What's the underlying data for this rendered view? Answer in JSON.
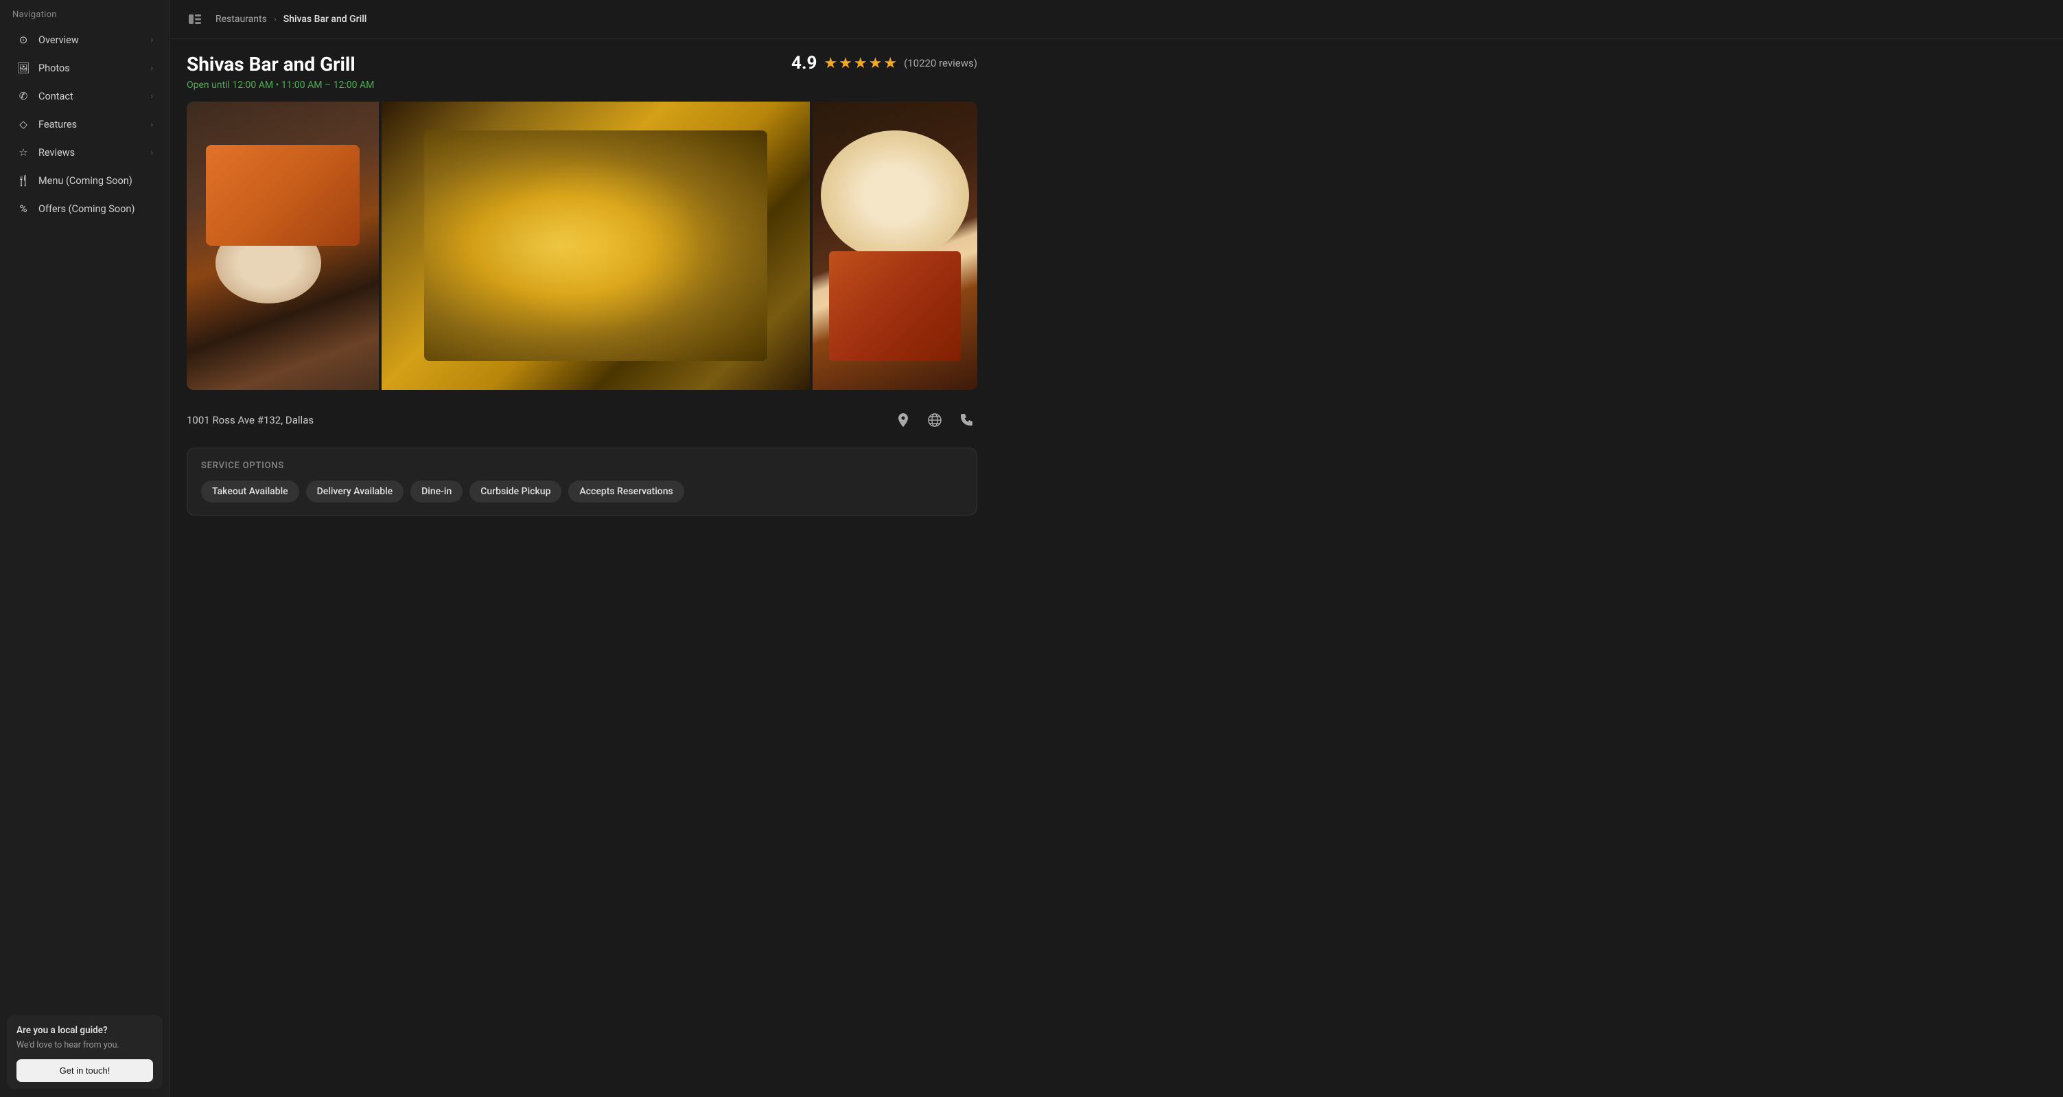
{
  "nav": {
    "label": "Navigation",
    "items": [
      {
        "id": "overview",
        "label": "Overview",
        "icon": "⊙"
      },
      {
        "id": "photos",
        "label": "Photos",
        "icon": "🖼"
      },
      {
        "id": "contact",
        "label": "Contact",
        "icon": "☎"
      },
      {
        "id": "features",
        "label": "Features",
        "icon": "◇"
      },
      {
        "id": "reviews",
        "label": "Reviews",
        "icon": "☆"
      },
      {
        "id": "menu",
        "label": "Menu (Coming Soon)",
        "icon": "🍴"
      },
      {
        "id": "offers",
        "label": "Offers (Coming Soon)",
        "icon": "%"
      }
    ]
  },
  "local_guide": {
    "title": "Are you a local guide?",
    "description": "We'd love to hear from you.",
    "button_label": "Get in touch!"
  },
  "topbar": {
    "breadcrumb_parent": "Restaurants",
    "breadcrumb_current": "Shivas Bar and Grill"
  },
  "restaurant": {
    "name": "Shivas Bar and Grill",
    "rating": "4.9",
    "review_count": "(10220 reviews)",
    "hours": "Open until 12:00 AM • 11:00 AM – 12:00 AM",
    "address": "1001 Ross Ave #132, Dallas"
  },
  "service_options": {
    "title": "Service Options",
    "badges": [
      "Takeout Available",
      "Delivery Available",
      "Dine-in",
      "Curbside Pickup",
      "Accepts Reservations"
    ]
  }
}
